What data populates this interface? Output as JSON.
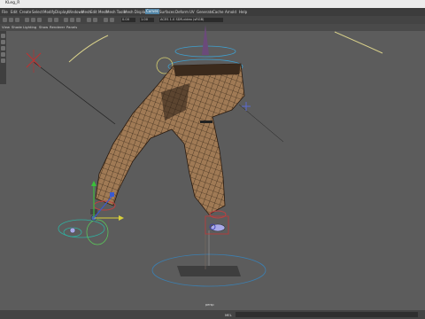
{
  "window": {
    "title": "KLeg_R"
  },
  "menu": {
    "items": [
      "File",
      "Edit",
      "Create",
      "Select",
      "Modify",
      "Display",
      "Windows",
      "Mesh",
      "Edit Mesh",
      "Mesh Tools",
      "Mesh Display",
      "Curves",
      "Surfaces",
      "Deform",
      "UV",
      "Generate",
      "Cache",
      "Arnold",
      "Help"
    ],
    "active_index": 11
  },
  "shelf": {
    "frame_value_1": "0.00",
    "frame_value_2": "1.00",
    "color_space": "ACES 1.0 SDR-video (sRGB)"
  },
  "panel_menu": {
    "items": [
      "View",
      "Shade",
      "Lighting",
      "Show",
      "Renderer",
      "Panels"
    ]
  },
  "viewport": {
    "camera_label": "persp"
  },
  "status": {
    "command_label": "MEL"
  },
  "colors": {
    "menu_active": "#5285a6",
    "viewport_bg": "#5c5c5c",
    "mesh": "#a07a55",
    "wire": "#1b1208"
  },
  "icons": [
    "move-icon",
    "rotate-icon",
    "scale-icon",
    "select-icon",
    "lasso-icon",
    "paint-icon",
    "grid-icon",
    "camera-icon"
  ]
}
